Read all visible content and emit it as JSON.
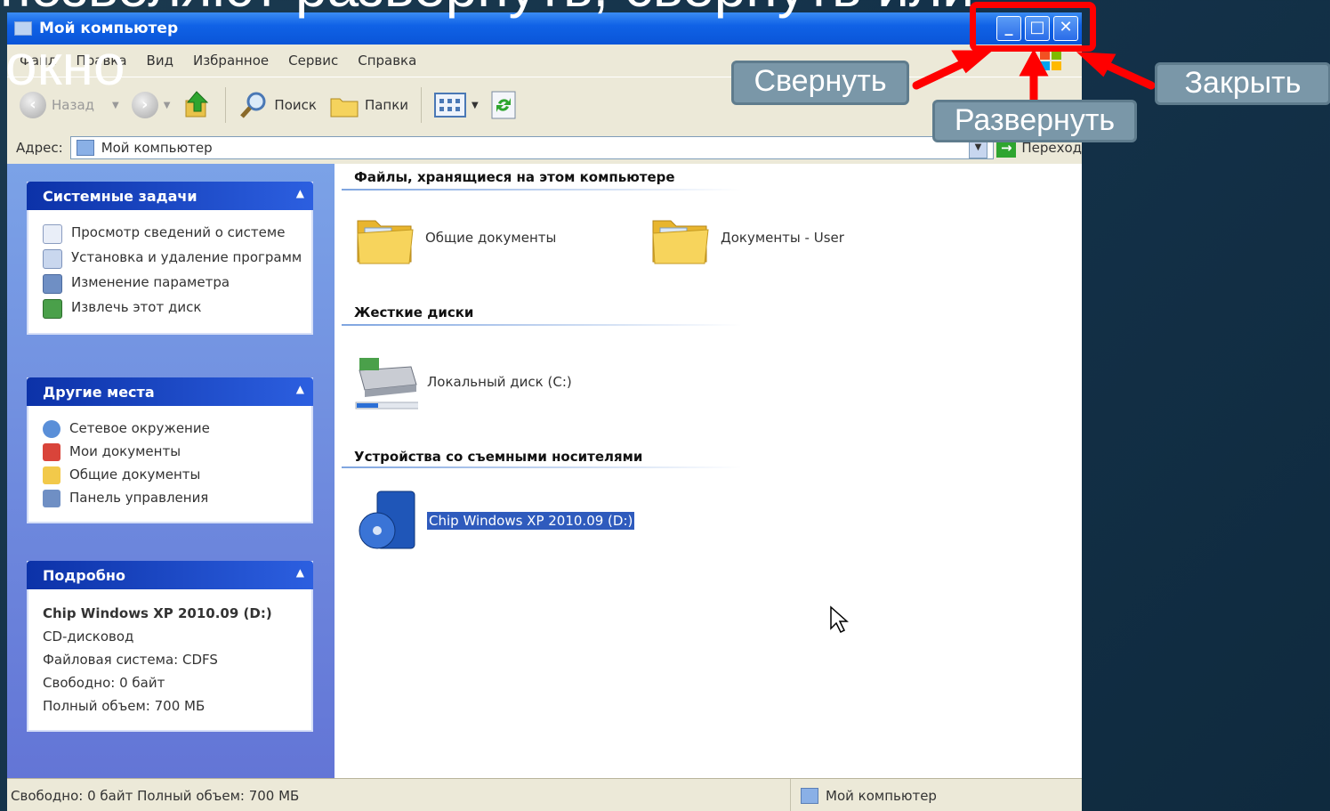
{
  "slide": {
    "title_line1": "позволяют развернуть, свернуть или",
    "title_line2": "окно"
  },
  "window": {
    "title": "Мой компьютер",
    "buttons": {
      "minimize": "_",
      "maximize": "□",
      "close": "✕"
    }
  },
  "menu": [
    "Файл",
    "Правка",
    "Вид",
    "Избранное",
    "Сервис",
    "Справка"
  ],
  "toolbar": {
    "back": "Назад",
    "search": "Поиск",
    "folders": "Папки"
  },
  "address": {
    "label": "Адрес:",
    "value": "Мой компьютер",
    "go": "Переход"
  },
  "sidebar": {
    "system_tasks": {
      "title": "Системные задачи",
      "items": [
        "Просмотр сведений о системе",
        "Установка и удаление программ",
        "Изменение параметра",
        "Извлечь этот диск"
      ]
    },
    "other_places": {
      "title": "Другие места",
      "items": [
        "Сетевое окружение",
        "Мои документы",
        "Общие документы",
        "Панель управления"
      ]
    },
    "details": {
      "title": "Подробно",
      "name": "Chip Windows XP 2010.09 (D:)",
      "type": "CD-дисковод",
      "fs": "Файловая система: CDFS",
      "free": "Свободно: 0 байт",
      "total": "Полный объем: 700 МБ"
    }
  },
  "content": {
    "section_files": "Файлы, хранящиеся на этом компьютере",
    "shared_docs": "Общие документы",
    "user_docs": "Документы - User",
    "section_drives": "Жесткие диски",
    "local_disk": "Локальный диск (C:)",
    "section_removable": "Устройства со съемными носителями",
    "cd_drive": "Chip Windows XP 2010.09 (D:)"
  },
  "status": {
    "left": "Свободно: 0 байт Полный объем: 700 МБ",
    "right": "Мой компьютер"
  },
  "callouts": {
    "minimize": "Свернуть",
    "maximize": "Развернуть",
    "close": "Закрыть"
  },
  "colors": {
    "highlight": "#ff0000",
    "callout_bg": "#7a97a8",
    "xp_blue": "#0c52c7"
  }
}
